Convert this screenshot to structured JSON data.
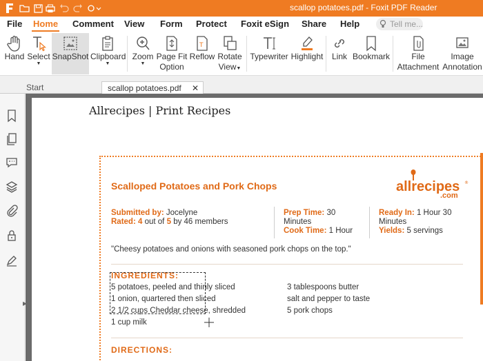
{
  "window": {
    "title": "scallop potatoes.pdf - Foxit PDF Reader"
  },
  "menu": {
    "items": [
      "File",
      "Home",
      "Comment",
      "View",
      "Form",
      "Protect",
      "Foxit eSign",
      "Share",
      "Help"
    ],
    "tell_me_placeholder": "Tell me..."
  },
  "ribbon": {
    "hand": "Hand",
    "select": "Select",
    "snapshot": "SnapShot",
    "clipboard": "Clipboard",
    "zoom": "Zoom",
    "page_fit_1": "Page Fit",
    "page_fit_2": "Option",
    "reflow": "Reflow",
    "rotate_1": "Rotate",
    "rotate_2": "View",
    "typewriter": "Typewriter",
    "highlight": "Highlight",
    "link": "Link",
    "bookmark": "Bookmark",
    "file_att_1": "File",
    "file_att_2": "Attachment",
    "image_ann_1": "Image",
    "image_ann_2": "Annotation"
  },
  "tabs": {
    "start": "Start",
    "doc": "scallop potatoes.pdf"
  },
  "doc": {
    "print_title": "Allrecipes | Print Recipes",
    "recipe_title": "Scalloped Potatoes and Pork Chops",
    "logo_text": "allrecipes",
    "logo_com": ".com",
    "submitted_label": "Submitted by:",
    "submitted_by": "Jocelyne",
    "rated_label": "Rated:",
    "rated_value": "4",
    "rated_out_of": "out of",
    "rated_max": "5",
    "rated_by": "by 46 members",
    "prep_label": "Prep Time:",
    "prep_value": "30",
    "prep_unit": "Minutes",
    "cook_label": "Cook Time:",
    "cook_value": "1 Hour",
    "ready_label": "Ready In:",
    "ready_value": "1 Hour 30",
    "ready_unit": "Minutes",
    "yields_label": "Yields:",
    "yields_value": "5 servings",
    "tagline": "\"Cheesy potatoes and onions with seasoned pork chops on the top.\"",
    "ingredients_heading": "INGREDIENTS:",
    "ingredients_left": [
      "5 potatoes, peeled and thinly sliced",
      "1 onion, quartered then sliced",
      "2 1/2 cups Cheddar cheese, shredded",
      "1 cup milk"
    ],
    "ingredients_right": [
      "3 tablespoons butter",
      "salt and pepper to taste",
      "5 pork chops"
    ],
    "directions_heading": "DIRECTIONS:"
  },
  "colors": {
    "accent": "#ef7b22",
    "recipe_orange": "#e06a17"
  }
}
